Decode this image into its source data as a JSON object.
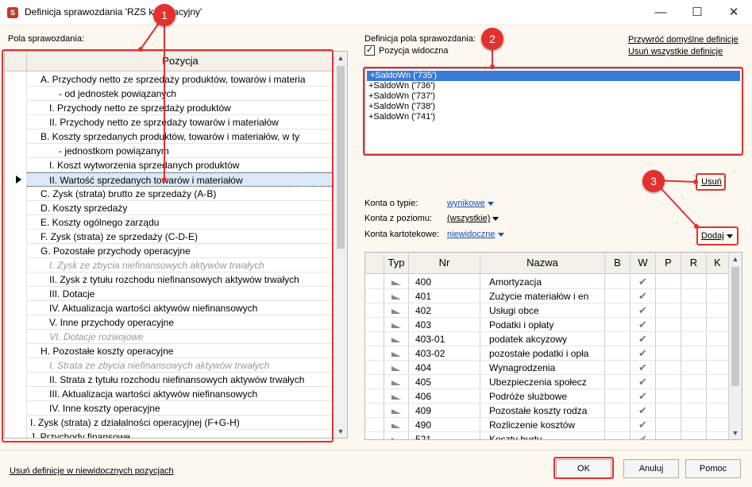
{
  "window": {
    "title": "Definicja sprawozdania 'RZS kalkulacyjny'",
    "minimize_glyph": "—",
    "maximize_glyph": "☐",
    "close_glyph": "✕",
    "app_icon": "report-icon"
  },
  "left": {
    "section_label": "Pola sprawozdania:",
    "column_header": "Pozycja",
    "rows": [
      {
        "text": "A. Przychody netto ze sprzedaży produktów, towarów i materia",
        "indent": 1,
        "style": "normal"
      },
      {
        "text": "- od jednostek powiązanych",
        "indent": 3,
        "style": "normal"
      },
      {
        "text": "I. Przychody netto ze sprzedaży produktów",
        "indent": 2,
        "style": "normal"
      },
      {
        "text": "II. Przychody netto ze sprzedaży towarów i materiałów",
        "indent": 2,
        "style": "normal"
      },
      {
        "text": "B. Koszty sprzedanych produktów, towarów i materiałów, w ty",
        "indent": 1,
        "style": "normal"
      },
      {
        "text": "- jednostkom powiązanym",
        "indent": 3,
        "style": "normal"
      },
      {
        "text": "I. Koszt wytworzenia sprzedanych produktów",
        "indent": 2,
        "style": "normal"
      },
      {
        "text": "II. Wartość sprzedanych towarów i materiałów",
        "indent": 2,
        "style": "selected"
      },
      {
        "text": "C. Zysk (strata) brutto ze sprzedaży (A-B)",
        "indent": 1,
        "style": "normal"
      },
      {
        "text": "D. Koszty sprzedaży",
        "indent": 1,
        "style": "normal"
      },
      {
        "text": "E. Koszty ogólnego zarządu",
        "indent": 1,
        "style": "normal"
      },
      {
        "text": "F. Zysk (strata) ze sprzedaży (C-D-E)",
        "indent": 1,
        "style": "normal"
      },
      {
        "text": "G. Pozostałe przychody operacyjne",
        "indent": 1,
        "style": "normal"
      },
      {
        "text": "I. Zysk ze zbycia niefinansowych aktywów trwałych",
        "indent": 2,
        "style": "disabled"
      },
      {
        "text": "II. Zysk z tytułu rozchodu niefinansowych aktywów trwałych",
        "indent": 2,
        "style": "normal"
      },
      {
        "text": "III. Dotacje",
        "indent": 2,
        "style": "normal"
      },
      {
        "text": "IV. Aktualizacja wartości aktywów niefinansowych",
        "indent": 2,
        "style": "normal"
      },
      {
        "text": "V. Inne przychody operacyjne",
        "indent": 2,
        "style": "normal"
      },
      {
        "text": "VI. Dotacje rozwojowe",
        "indent": 2,
        "style": "disabled"
      },
      {
        "text": "H. Pozostałe koszty operacyjne",
        "indent": 1,
        "style": "normal"
      },
      {
        "text": "I. Strata ze zbycia niefinansowych aktywów trwałych",
        "indent": 2,
        "style": "disabled"
      },
      {
        "text": "II. Strata z tytułu rozchodu niefinansowych aktywów trwałych",
        "indent": 2,
        "style": "normal"
      },
      {
        "text": "III. Aktualizacja wartości aktywów niefinansowych",
        "indent": 2,
        "style": "normal"
      },
      {
        "text": "IV. Inne koszty operacyjne",
        "indent": 2,
        "style": "normal"
      },
      {
        "text": "I. Zysk (strata) z działalności operacyjnej (F+G-H)",
        "indent": 0,
        "style": "normal"
      },
      {
        "text": "J. Przychody finansowe",
        "indent": 0,
        "style": "normal"
      }
    ]
  },
  "right": {
    "definition_label": "Definicja pola sprawozdania:",
    "visible_checkbox_label": "Pozycja widoczna",
    "visible_checked": true,
    "restore_link": "Przywróć domyślne definicje",
    "delete_all_link": "Usuń wszystkie definicje",
    "definitions": [
      "+SaldoWn ('735')",
      "+SaldoWn ('736')",
      "+SaldoWn ('737')",
      "+SaldoWn ('738')",
      "+SaldoWn ('741')"
    ],
    "remove_button": "Usuń",
    "add_button": "Dodaj",
    "filters": [
      {
        "label": "Konta o typie:",
        "value": "wynikowe",
        "linked": true
      },
      {
        "label": "Konta z poziomu:",
        "value": "(wszystkie)",
        "linked": false
      },
      {
        "label": "Konta kartotekowe:",
        "value": "niewidoczne",
        "linked": true
      }
    ],
    "grid_columns": [
      "Typ",
      "Nr",
      "Nazwa",
      "B",
      "W",
      "P",
      "R",
      "K"
    ],
    "accounts": [
      {
        "nr": "400",
        "nazwa": "Amortyzacja",
        "w": true
      },
      {
        "nr": "401",
        "nazwa": "Zużycie materiałów i en",
        "w": true
      },
      {
        "nr": "402",
        "nazwa": "Usługi obce",
        "w": true
      },
      {
        "nr": "403",
        "nazwa": "Podatki i opłaty",
        "w": true
      },
      {
        "nr": "403-01",
        "nazwa": "podatek akcyzowy",
        "w": true
      },
      {
        "nr": "403-02",
        "nazwa": "pozostałe podatki i opła",
        "w": true
      },
      {
        "nr": "404",
        "nazwa": "Wynagrodzenia",
        "w": true
      },
      {
        "nr": "405",
        "nazwa": "Ubezpieczenia społecz",
        "w": true
      },
      {
        "nr": "406",
        "nazwa": "Podróże służbowe",
        "w": true
      },
      {
        "nr": "409",
        "nazwa": "Pozostałe koszty rodza",
        "w": true
      },
      {
        "nr": "490",
        "nazwa": "Rozliczenie kosztów",
        "w": true
      },
      {
        "nr": "521",
        "nazwa": "Koszty hurtu",
        "w": true
      }
    ],
    "check_glyph": "✔"
  },
  "footer": {
    "delete_invisible_link": "Usuń definicje w niewidocznych pozycjach",
    "ok_button": "OK",
    "cancel_button": "Anuluj",
    "help_button": "Pomoc"
  },
  "annotations": {
    "badge_1": "1",
    "badge_2": "2",
    "badge_3": "3",
    "highlight_color": "#e53030"
  }
}
